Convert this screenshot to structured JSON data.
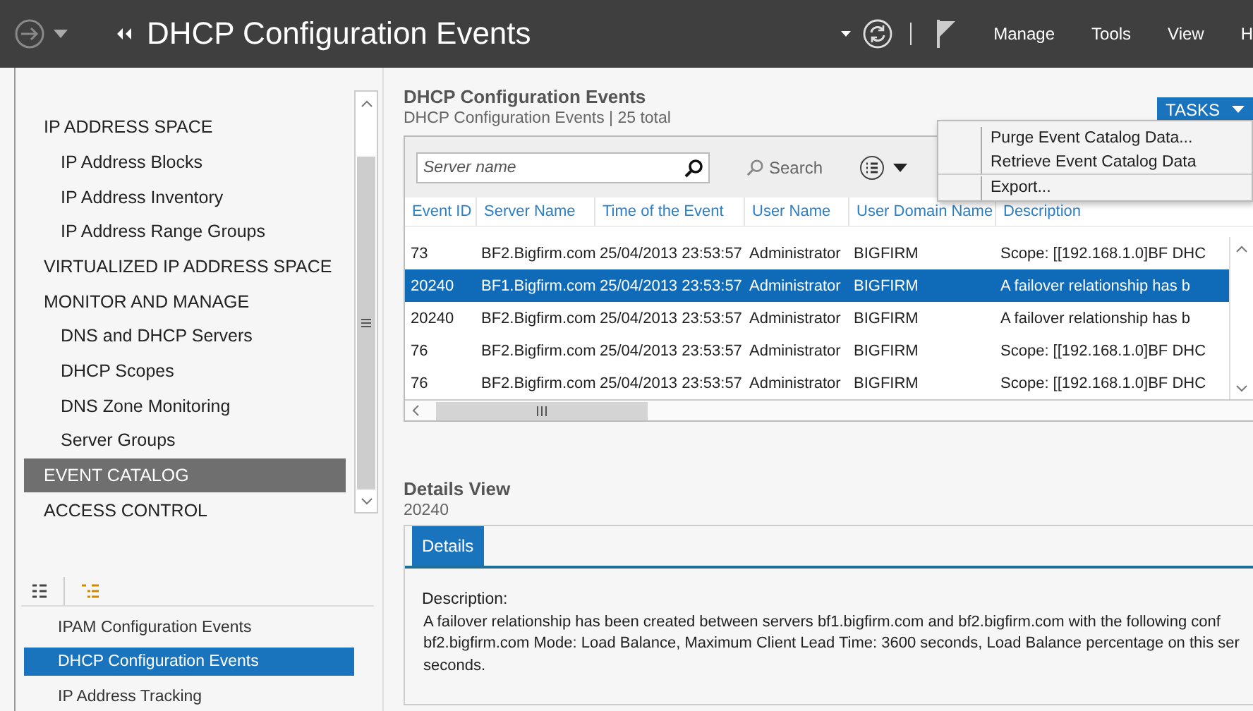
{
  "header": {
    "title": "DHCP Configuration Events",
    "menus": [
      "Manage",
      "Tools",
      "View",
      "H"
    ]
  },
  "nav": {
    "items": [
      {
        "label": "IP ADDRESS SPACE",
        "selected": false,
        "children": [
          {
            "label": "IP Address Blocks",
            "selected": false
          },
          {
            "label": "IP Address Inventory",
            "selected": false
          },
          {
            "label": "IP Address Range Groups",
            "selected": false
          }
        ]
      },
      {
        "label": "VIRTUALIZED IP ADDRESS SPACE",
        "selected": false
      },
      {
        "label": "MONITOR AND MANAGE",
        "selected": false,
        "children": [
          {
            "label": "DNS and DHCP Servers",
            "selected": false
          },
          {
            "label": "DHCP Scopes",
            "selected": false
          },
          {
            "label": "DNS Zone Monitoring",
            "selected": false
          },
          {
            "label": "Server Groups",
            "selected": false
          }
        ]
      },
      {
        "label": "EVENT CATALOG",
        "selected": true
      },
      {
        "label": "ACCESS CONTROL",
        "selected": false
      }
    ]
  },
  "sub_nav": {
    "items": [
      {
        "label": "IPAM Configuration Events",
        "selected": false
      },
      {
        "label": "DHCP Configuration Events",
        "selected": true
      },
      {
        "label": "IP Address Tracking",
        "selected": false
      }
    ]
  },
  "events": {
    "title": "DHCP Configuration Events",
    "subtitle": "DHCP Configuration Events | 25 total",
    "tasks": "TASKS",
    "tasks_menu": [
      "Purge Event Catalog Data...",
      "Retrieve Event Catalog Data",
      "Export..."
    ],
    "filter_placeholder": "Server name",
    "search": "Search",
    "columns": [
      "Event ID",
      "Server Name",
      "Time of the Event",
      "User Name",
      "User Domain Name",
      "Description"
    ],
    "rows": [
      {
        "cells": [
          "73",
          "BF2.Bigfirm.com",
          "25/04/2013 23:53:57",
          "Administrator",
          "BIGFIRM",
          "Scope: [[192.168.1.0]BF DHC"
        ],
        "selected": false
      },
      {
        "cells": [
          "20240",
          "BF1.Bigfirm.com",
          "25/04/2013 23:53:57",
          "Administrator",
          "BIGFIRM",
          "A failover relationship has b"
        ],
        "selected": true
      },
      {
        "cells": [
          "20240",
          "BF2.Bigfirm.com",
          "25/04/2013 23:53:57",
          "Administrator",
          "BIGFIRM",
          "A failover relationship has b"
        ],
        "selected": false
      },
      {
        "cells": [
          "76",
          "BF2.Bigfirm.com",
          "25/04/2013 23:53:57",
          "Administrator",
          "BIGFIRM",
          "Scope: [[192.168.1.0]BF DHC"
        ],
        "selected": false
      },
      {
        "cells": [
          "76",
          "BF2.Bigfirm.com",
          "25/04/2013 23:53:57",
          "Administrator",
          "BIGFIRM",
          "Scope: [[192.168.1.0]BF DHC"
        ],
        "selected": false
      }
    ]
  },
  "details": {
    "title": "Details View",
    "subtitle": "20240",
    "tabs": [
      {
        "label": "Details",
        "selected": true
      }
    ],
    "label": "Description:",
    "lines": [
      "A failover relationship has been created between servers bf1.bigfirm.com and bf2.bigfirm.com with the following conf",
      "bf2.bigfirm.com Mode: Load Balance, Maximum Client Lead Time: 3600 seconds, Load Balance percentage on this ser",
      "seconds."
    ]
  }
}
